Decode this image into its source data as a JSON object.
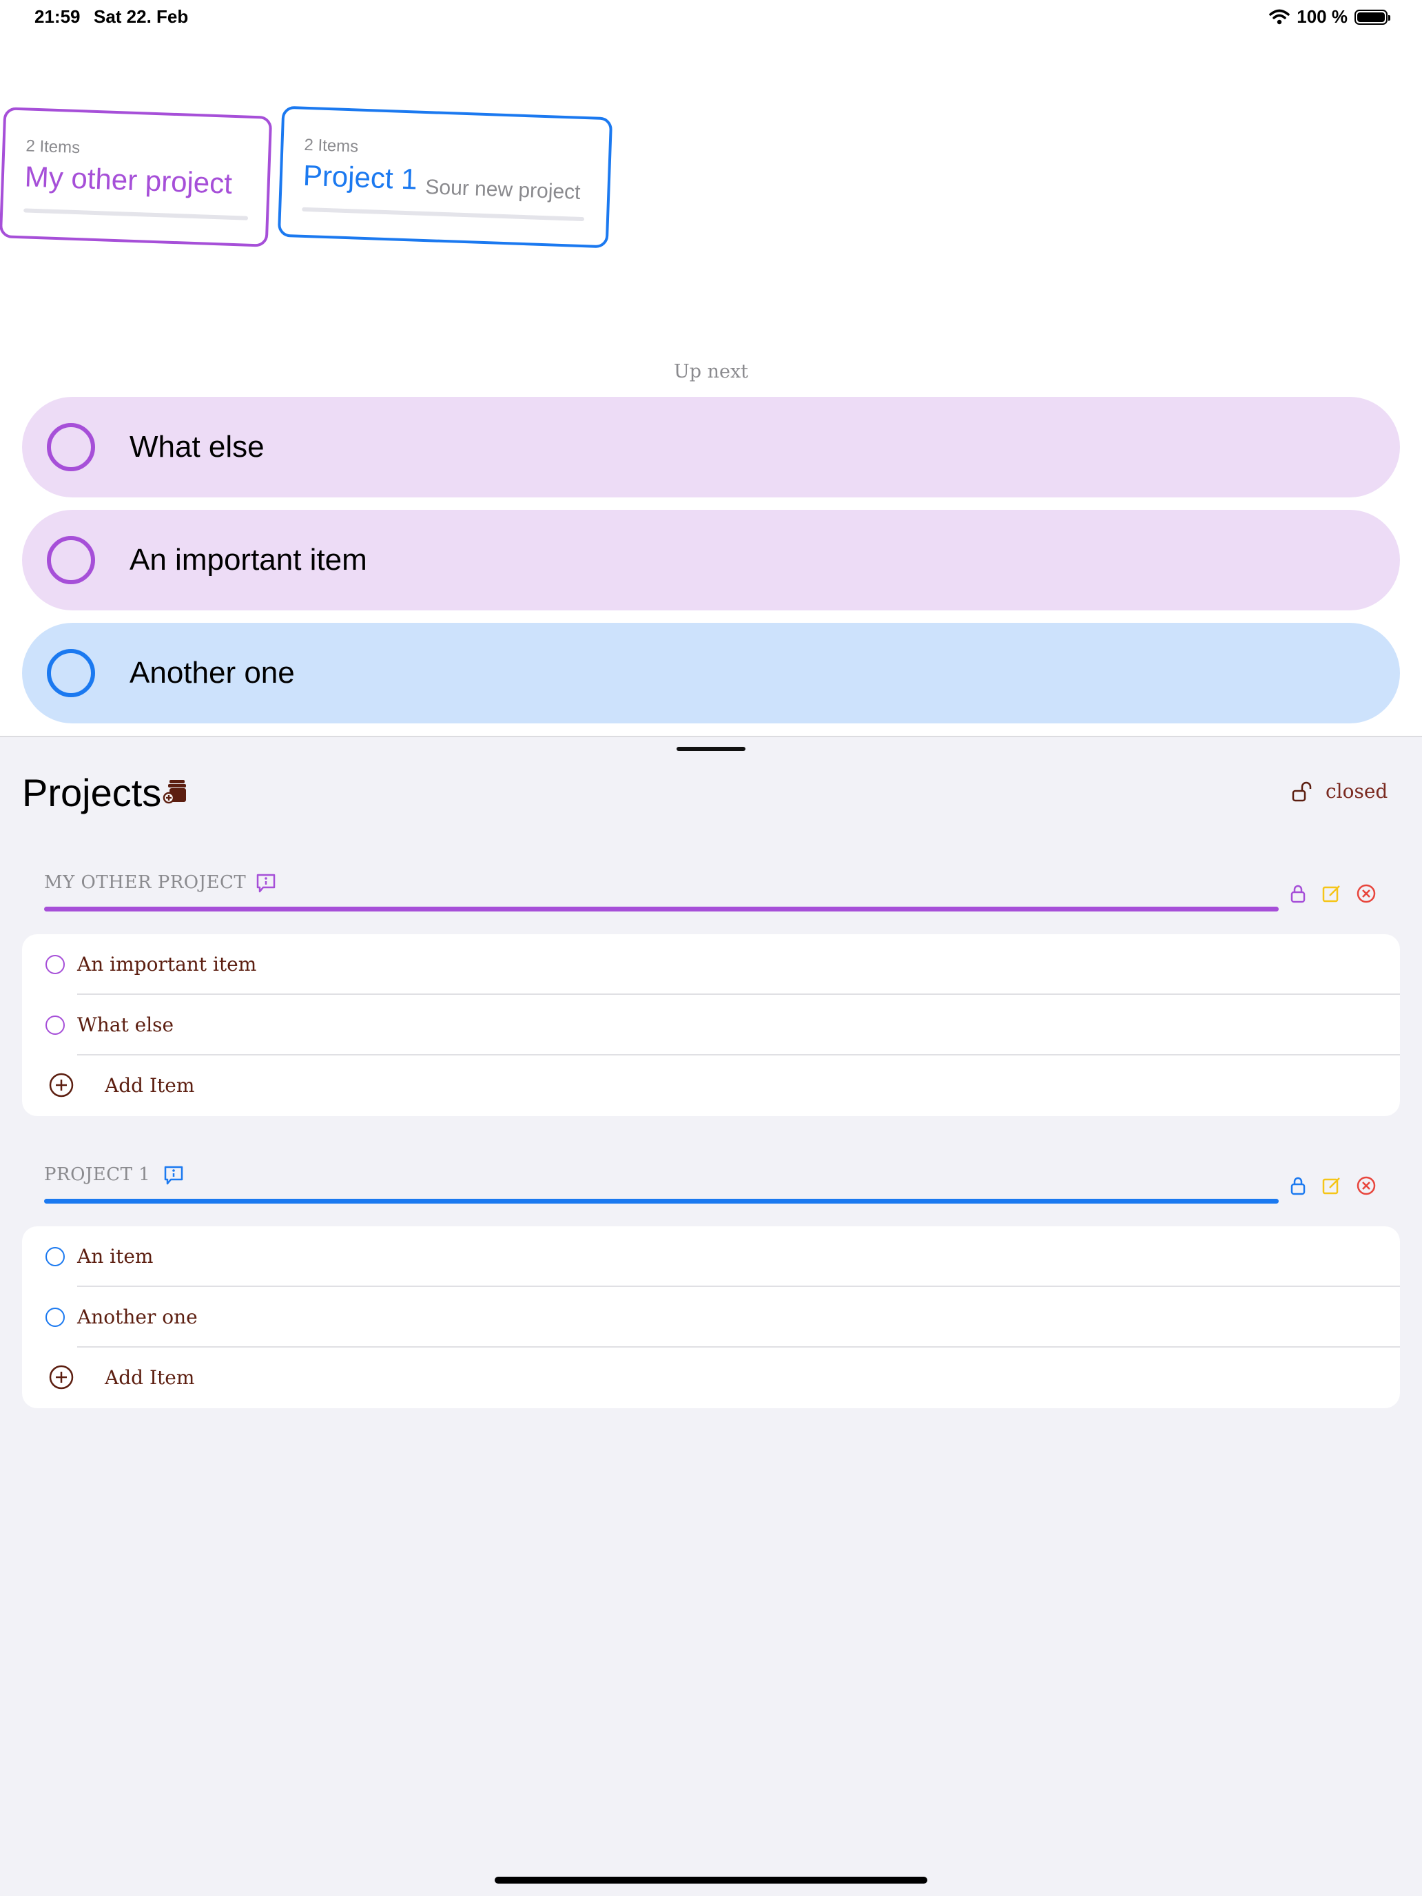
{
  "status_bar": {
    "time": "21:59",
    "date": "Sat 22. Feb",
    "battery": "100 %"
  },
  "cards": [
    {
      "count": "2 Items",
      "title": "My other project",
      "subtitle": "",
      "color": "#a64fd8"
    },
    {
      "count": "2 Items",
      "title": "Project 1",
      "subtitle": "Sour new project",
      "color": "#1b79f0"
    }
  ],
  "up_next": {
    "label": "Up next",
    "items": [
      {
        "text": "What else",
        "color": "#a64fd8",
        "bg": "#eddcf6"
      },
      {
        "text": "An important item",
        "color": "#a64fd8",
        "bg": "#eddcf6"
      },
      {
        "text": "Another one",
        "color": "#1b79f0",
        "bg": "#cde2fc"
      }
    ]
  },
  "projects": {
    "title": "Projects",
    "lock_label": "closed",
    "sections": [
      {
        "header": "MY OTHER PROJECT",
        "color": "#a64fd8",
        "items": [
          "An important item",
          "What else"
        ],
        "add_label": "Add Item"
      },
      {
        "header": "PROJECT 1",
        "color": "#1b79f0",
        "items": [
          "An item",
          "Another one"
        ],
        "add_label": "Add Item"
      }
    ]
  },
  "colors": {
    "accent_text": "#5c1e10",
    "edit": "#f5c518",
    "delete": "#e8453c"
  }
}
